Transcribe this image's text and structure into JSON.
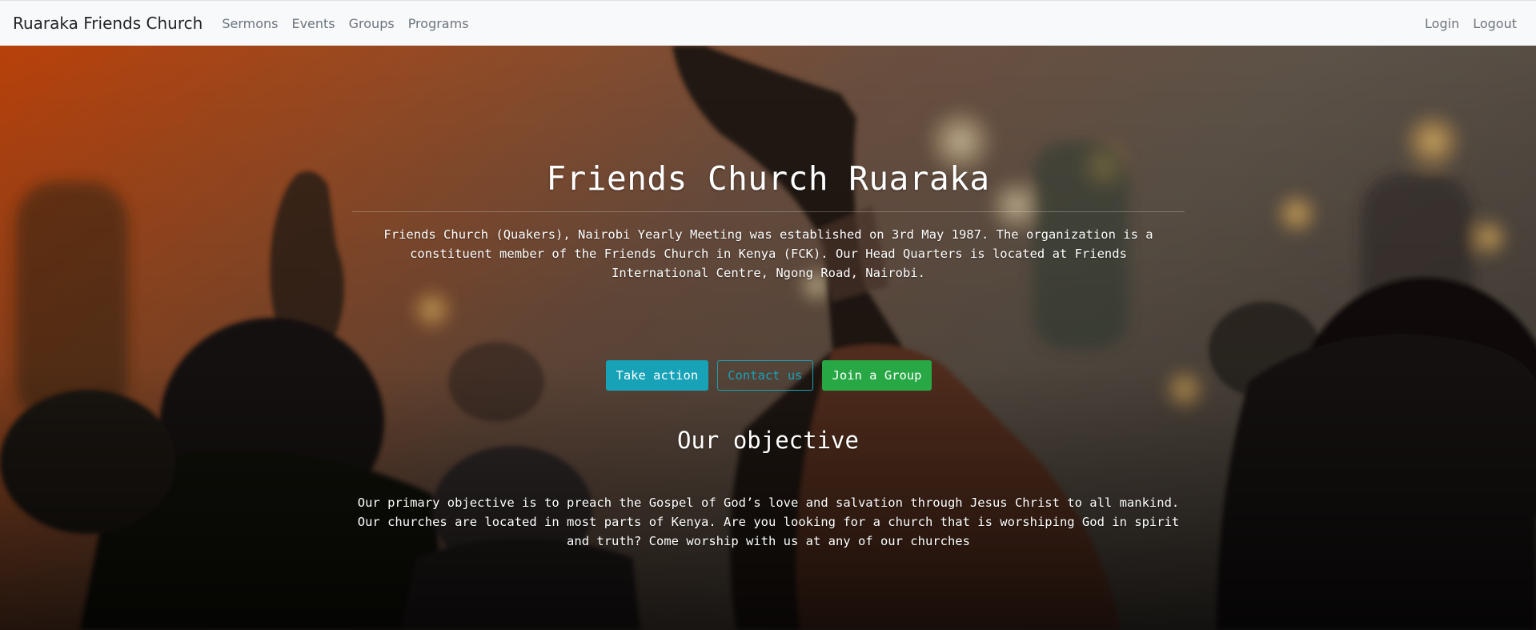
{
  "navbar": {
    "brand": "Ruaraka Friends Church",
    "links": [
      "Sermons",
      "Events",
      "Groups",
      "Programs"
    ],
    "right_links": [
      "Login",
      "Logout"
    ]
  },
  "hero": {
    "background_image": "concert-crowd-hands-raised-photo",
    "title": "Friends Church Ruaraka",
    "lead": "Friends Church (Quakers), Nairobi Yearly Meeting was established on 3rd May 1987. The organization is a constituent member of the Friends Church in Kenya (FCK). Our Head Quarters is located at Friends International Centre, Ngong Road, Nairobi.",
    "buttons": {
      "take_action": "Take action",
      "contact_us": "Contact us",
      "join_group": "Join a Group"
    },
    "objective_title": "Our objective",
    "objective_text": "Our primary objective is to preach the Gospel of God’s love and salvation through Jesus Christ to all mankind. Our churches are located in most parts of Kenya. Are you looking for a church that is worshiping God in spirit and truth? Come worship with us at any of our churches"
  },
  "colors": {
    "navbar_bg": "#f8f9fa",
    "brand_text": "#212529",
    "nav_link": "#6c757d",
    "info": "#17a2b8",
    "success": "#28a745"
  }
}
